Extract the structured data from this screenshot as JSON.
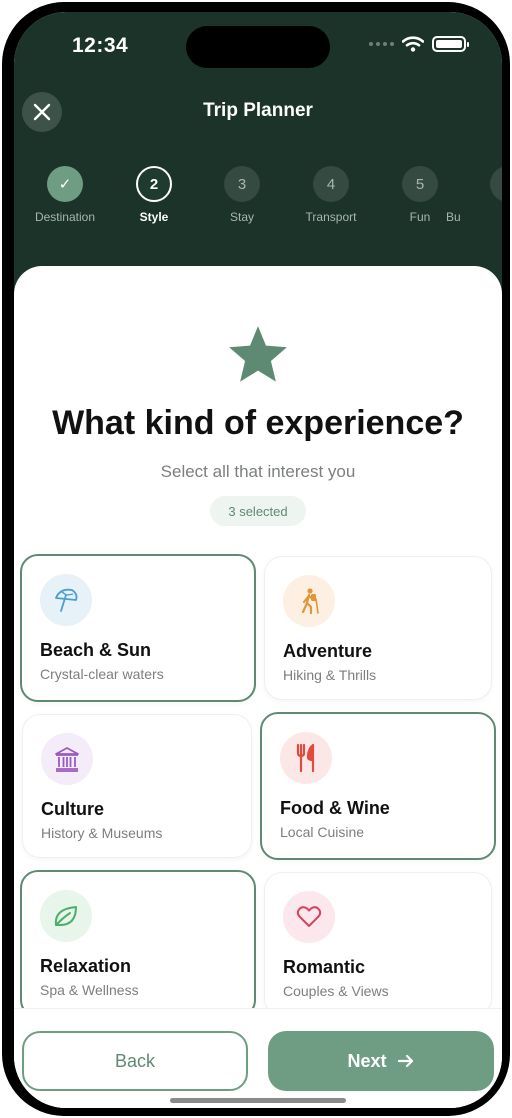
{
  "status_bar": {
    "time": "12:34"
  },
  "header": {
    "title": "Trip Planner"
  },
  "steps": [
    {
      "number": "✓",
      "label": "Destination",
      "state": "done"
    },
    {
      "number": "2",
      "label": "Style",
      "state": "current"
    },
    {
      "number": "3",
      "label": "Stay",
      "state": "upcoming"
    },
    {
      "number": "4",
      "label": "Transport",
      "state": "upcoming"
    },
    {
      "number": "5",
      "label": "Fun",
      "state": "upcoming"
    },
    {
      "number": "",
      "label": "Bu",
      "state": "upcoming"
    }
  ],
  "main": {
    "heading": "What kind of experience?",
    "subheading": "Select all that interest you",
    "selected_count": "3 selected"
  },
  "options": [
    {
      "title": "Beach & Sun",
      "subtitle": "Crystal-clear waters",
      "icon": "beach-umbrella-icon",
      "selected": true
    },
    {
      "title": "Adventure",
      "subtitle": "Hiking & Thrills",
      "icon": "hiker-icon",
      "selected": false
    },
    {
      "title": "Culture",
      "subtitle": "History & Museums",
      "icon": "museum-icon",
      "selected": false
    },
    {
      "title": "Food & Wine",
      "subtitle": "Local Cuisine",
      "icon": "fork-knife-icon",
      "selected": true
    },
    {
      "title": "Relaxation",
      "subtitle": "Spa & Wellness",
      "icon": "leaf-icon",
      "selected": true
    },
    {
      "title": "Romantic",
      "subtitle": "Couples & Views",
      "icon": "heart-icon",
      "selected": false
    }
  ],
  "footer": {
    "back_label": "Back",
    "next_label": "Next"
  },
  "colors": {
    "header_bg": "#1b3328",
    "accent": "#6f9d84",
    "accent_dark": "#5e8a73"
  }
}
